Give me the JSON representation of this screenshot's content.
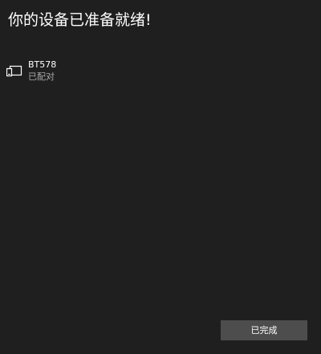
{
  "dialog": {
    "title": "你的设备已准备就绪!"
  },
  "device": {
    "icon": "device-icon",
    "name": "BT578",
    "status": "已配对"
  },
  "actions": {
    "done_label": "已完成"
  },
  "colors": {
    "background": "#1f1f1f",
    "button": "#4d4d4d",
    "secondary_text": "#a8a8a8"
  }
}
